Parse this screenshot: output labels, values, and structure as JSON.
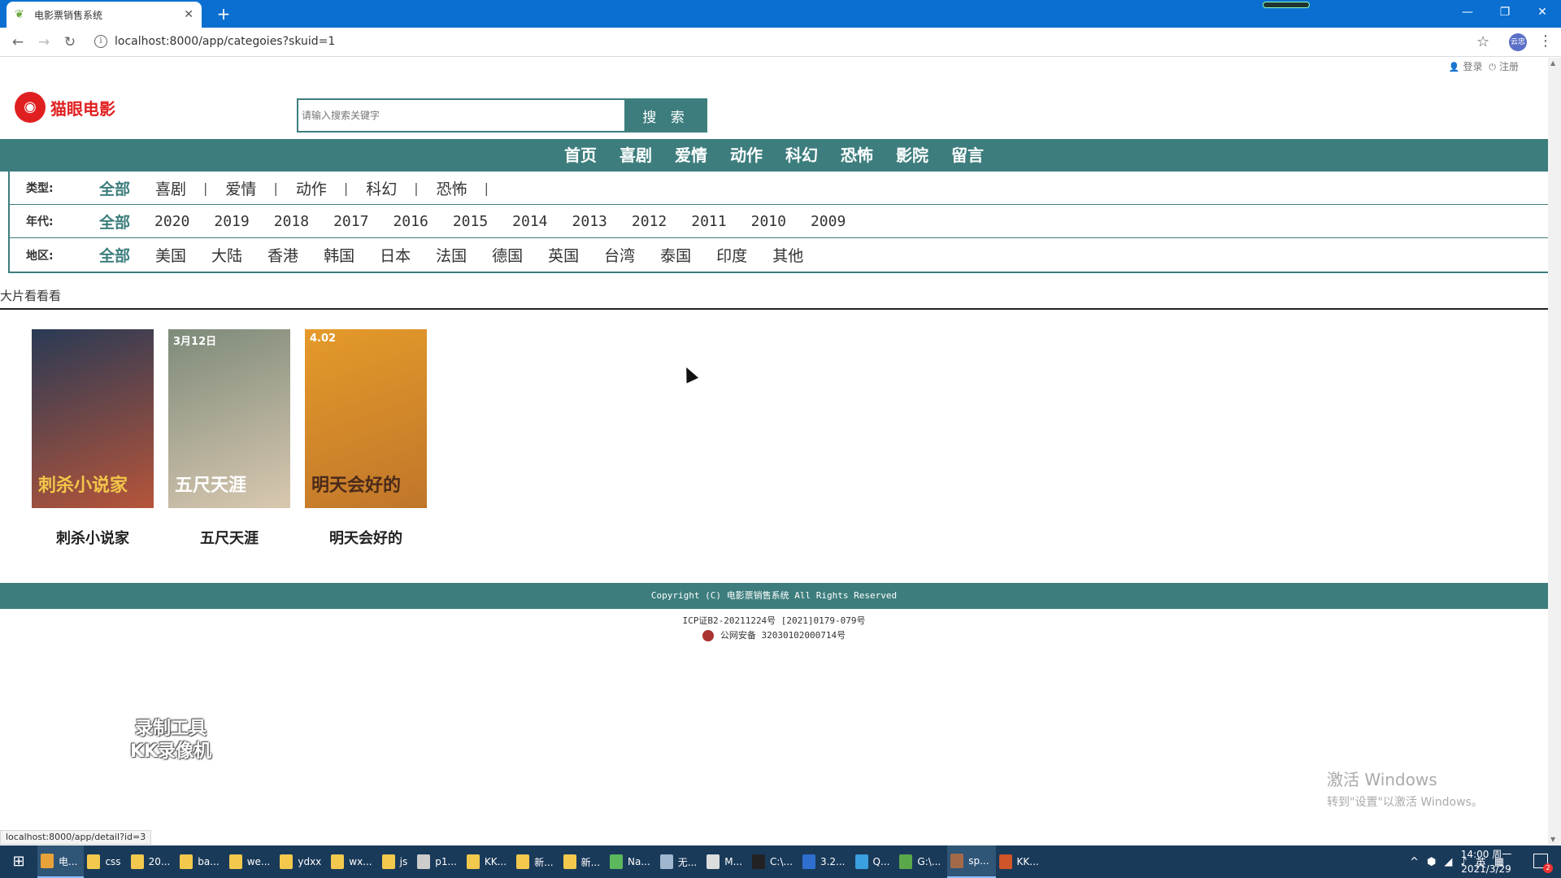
{
  "browser": {
    "tab_title": "电影票销售系统",
    "url": "localhost:8000/app/categoies?skuid=1",
    "profile_label": "云忠",
    "status_url": "localhost:8000/app/detail?id=3"
  },
  "site": {
    "top_links": {
      "login": "登录",
      "register": "注册"
    },
    "logo_text": "猫眼电影",
    "search": {
      "placeholder": "请输入搜索关键字",
      "button": "搜 索"
    },
    "nav": [
      "首页",
      "喜剧",
      "爱情",
      "动作",
      "科幻",
      "恐怖",
      "影院",
      "留言"
    ],
    "filters": {
      "type": {
        "label": "类型:",
        "items": [
          "全部",
          "喜剧",
          "爱情",
          "动作",
          "科幻",
          "恐怖"
        ]
      },
      "year": {
        "label": "年代:",
        "items": [
          "全部",
          "2020",
          "2019",
          "2018",
          "2017",
          "2016",
          "2015",
          "2014",
          "2013",
          "2012",
          "2011",
          "2010",
          "2009"
        ]
      },
      "region": {
        "label": "地区:",
        "items": [
          "全部",
          "美国",
          "大陆",
          "香港",
          "韩国",
          "日本",
          "法国",
          "德国",
          "英国",
          "台湾",
          "泰国",
          "印度",
          "其他"
        ]
      }
    },
    "section_title": "大片看看看",
    "movies": [
      {
        "title": "刺杀小说家",
        "poster_text": "刺杀小说家",
        "colors": [
          "#2a3a55",
          "#b6553a"
        ]
      },
      {
        "title": "五尺天涯",
        "poster_text": "五尺天涯",
        "poster_sub": "3月12日",
        "colors": [
          "#7d8a7a",
          "#d9c8b0"
        ]
      },
      {
        "title": "明天会好的",
        "poster_text": "明天会好的",
        "poster_sub": "4.02",
        "colors": [
          "#e59a2a",
          "#c0762a"
        ]
      }
    ],
    "footer": {
      "copyright": "Copyright (C) 电影票销售系统 All Rights Reserved",
      "icp": "ICP证B2-20211224号 [2021]0179-079号",
      "police": "公网安备 32030102000714号"
    }
  },
  "overlay": {
    "recorder_line1": "录制工具",
    "recorder_line2": "KK录像机",
    "activate_line1": "激活 Windows",
    "activate_line2": "转到\"设置\"以激活 Windows。"
  },
  "taskbar": {
    "items": [
      {
        "label": "电...",
        "icon_color": "#e7a33a",
        "active": true
      },
      {
        "label": "css",
        "icon_color": "#f2c94c"
      },
      {
        "label": "20...",
        "icon_color": "#f2c94c"
      },
      {
        "label": "ba...",
        "icon_color": "#f2c94c"
      },
      {
        "label": "we...",
        "icon_color": "#f2c94c"
      },
      {
        "label": "ydxx",
        "icon_color": "#f2c94c"
      },
      {
        "label": "wx...",
        "icon_color": "#f2c94c"
      },
      {
        "label": "js",
        "icon_color": "#f2c94c"
      },
      {
        "label": "p1...",
        "icon_color": "#cccccc"
      },
      {
        "label": "KK...",
        "icon_color": "#f2c94c"
      },
      {
        "label": "新...",
        "icon_color": "#f2c94c"
      },
      {
        "label": "新...",
        "icon_color": "#f2c94c"
      },
      {
        "label": "Na...",
        "icon_color": "#5cb85c"
      },
      {
        "label": "无...",
        "icon_color": "#9fb8d0"
      },
      {
        "label": "M...",
        "icon_color": "#dddddd"
      },
      {
        "label": "C:\\...",
        "icon_color": "#222222"
      },
      {
        "label": "3.2...",
        "icon_color": "#2f6fd0"
      },
      {
        "label": "Q...",
        "icon_color": "#3aa0e0"
      },
      {
        "label": "G:\\...",
        "icon_color": "#5aa84a"
      },
      {
        "label": "sp...",
        "icon_color": "#a36a4a",
        "active": true
      },
      {
        "label": "KK...",
        "icon_color": "#d0552a"
      }
    ],
    "tray_lang": "英",
    "time": "14:00 周一",
    "date": "2021/3/29",
    "notify_count": "2"
  }
}
